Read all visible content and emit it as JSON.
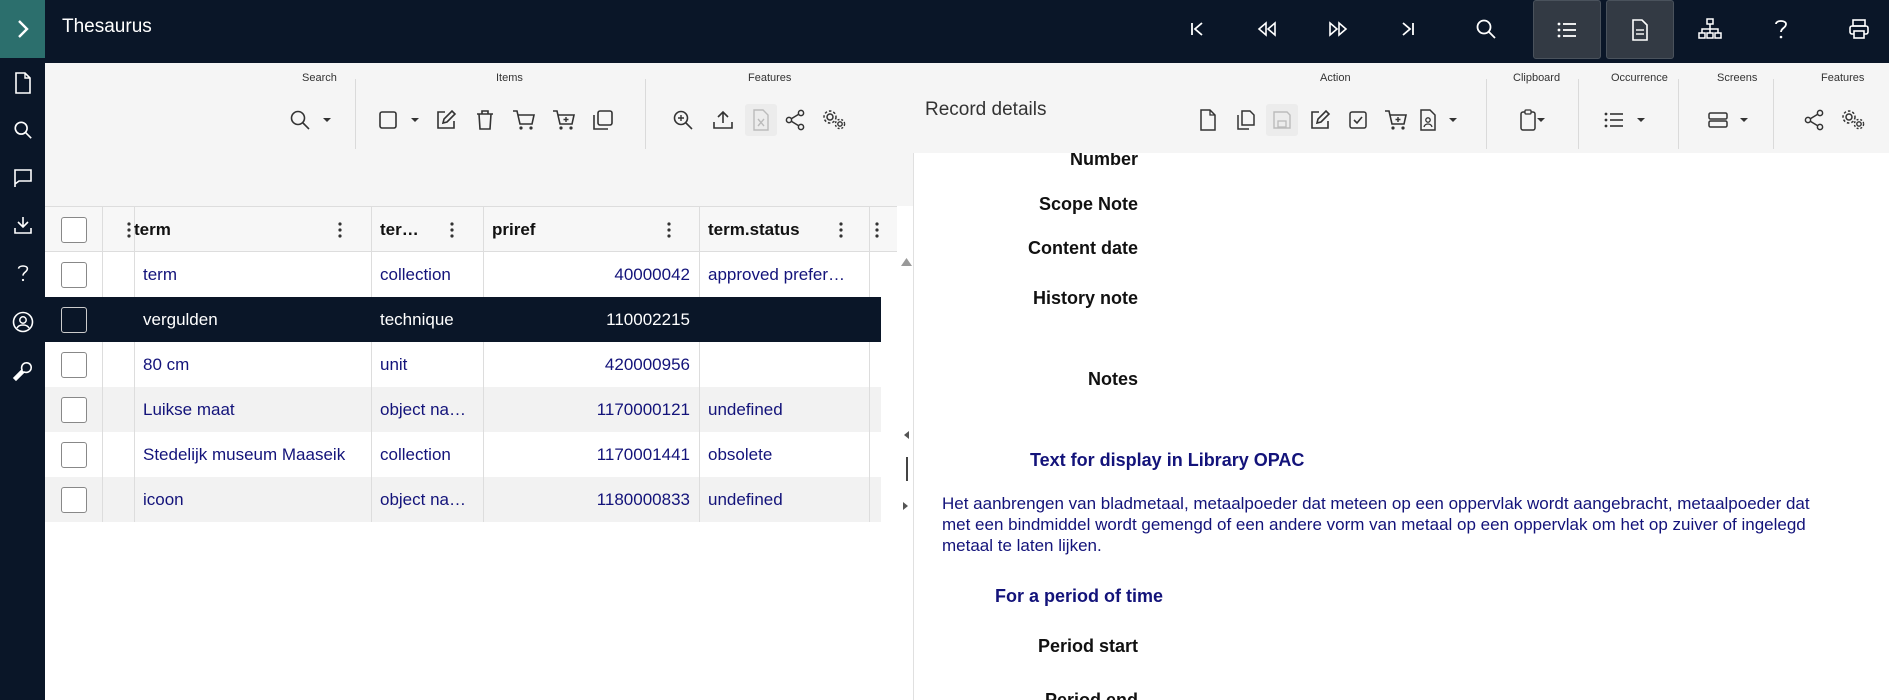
{
  "app": {
    "title": "Thesaurus"
  },
  "topbar": {
    "icons": [
      "chevron-right-icon",
      "first-record-icon",
      "previous-page-icon",
      "next-page-icon",
      "last-record-icon",
      "search-icon",
      "list-view-icon",
      "detail-view-icon",
      "hierarchy-icon",
      "help-icon",
      "print-icon"
    ]
  },
  "sidebar": {
    "icons": [
      "document-icon",
      "search-icon",
      "flag-icon",
      "download-icon",
      "help-icon",
      "user-icon",
      "wrench-icon"
    ]
  },
  "toolbar_left": {
    "groups": {
      "search": "Search",
      "items": "Items",
      "features": "Features"
    }
  },
  "toolbar_right": {
    "title": "Record details",
    "groups": {
      "action": "Action",
      "clipboard": "Clipboard",
      "occurrence": "Occurrence",
      "screens": "Screens",
      "features": "Features"
    }
  },
  "grid": {
    "columns": [
      "term",
      "ter…",
      "priref",
      "term.status"
    ],
    "rows": [
      {
        "term": "term",
        "type": "collection",
        "priref": "40000042",
        "status": "approved prefer…",
        "selected": false
      },
      {
        "term": "vergulden",
        "type": "technique",
        "priref": "110002215",
        "status": "",
        "selected": true
      },
      {
        "term": "80 cm",
        "type": "unit",
        "priref": "420000956",
        "status": "",
        "selected": false
      },
      {
        "term": "Luikse maat",
        "type": "object na…",
        "priref": "1170000121",
        "status": "undefined",
        "selected": false
      },
      {
        "term": "Stedelijk museum Maaseik",
        "type": "collection",
        "priref": "1170001441",
        "status": "obsolete",
        "selected": false
      },
      {
        "term": "icoon",
        "type": "object na…",
        "priref": "1180000833",
        "status": "undefined",
        "selected": false
      }
    ]
  },
  "details": {
    "labels": {
      "number": "Number",
      "scope_note": "Scope Note",
      "content_date": "Content date",
      "history_note": "History note",
      "notes": "Notes",
      "period_start": "Period start",
      "period_end": "Period end"
    },
    "sections": {
      "opac": "Text for display in Library OPAC",
      "period": "For a period of time"
    },
    "opac_text": "Het aanbrengen van bladmetaal, metaalpoeder dat meteen op een oppervlak wordt aangebracht, metaalpoeder dat met een bindmiddel wordt gemengd of een andere vorm van metaal op een oppervlak om het op zuiver of ingelegd metaal te laten lijken."
  },
  "colors": {
    "nav_bg": "#0a1628",
    "accent_teal": "#2c6f6d",
    "link_text": "#13137a"
  }
}
